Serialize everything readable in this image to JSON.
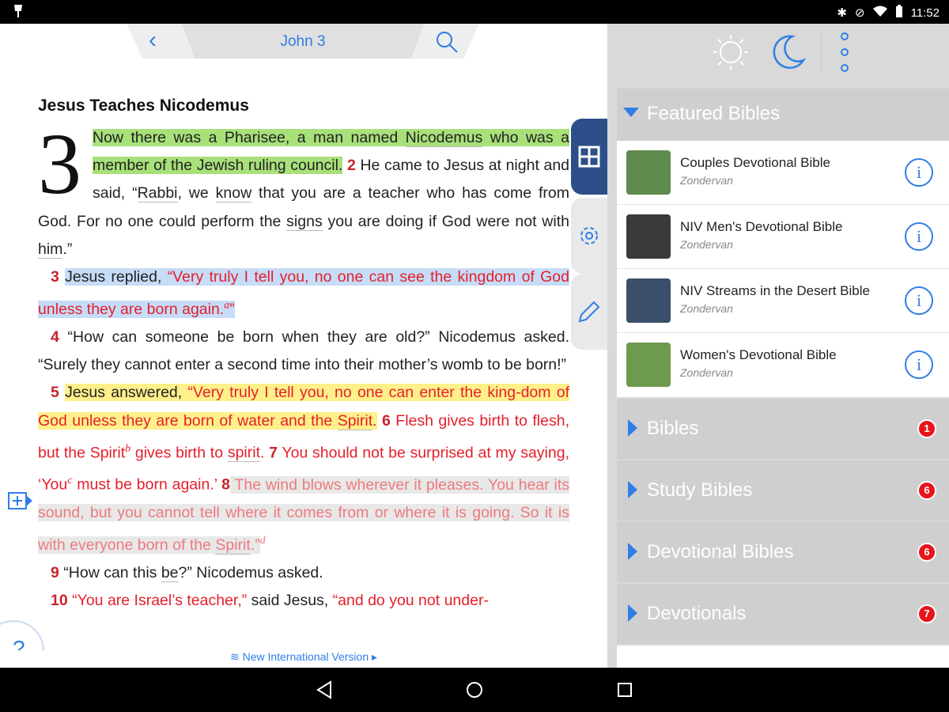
{
  "status_bar": {
    "time": "11:52"
  },
  "reader": {
    "chapter_ref": "John 3",
    "section_title": "Jesus Teaches Nicodemus",
    "chapter_number": "3",
    "version_label": "New International Version",
    "v1_a": "Now there was a Pharisee, a man named ",
    "v1_b": "Nicodemus",
    "v1_c": " who was a member of the Jewish ruling council.",
    "v2_num": "2",
    "v2_a": " He came to Jesus at night and said, “",
    "v2_rabbi": "Rabbi",
    "v2_b": ", we ",
    "v2_know": "know",
    "v2_c": " that you are a teacher who has come from God. For no one could perform the ",
    "v2_signs": "signs",
    "v2_d": " you are doing if God were not with ",
    "v2_him": "him",
    "v2_e": ".”",
    "v3_num": "3",
    "v3_a": "Jesus replied, ",
    "v3_b": "“Very truly I tell you, no one can see the kingdom of God unless they are born again.",
    "v3_sup": "a",
    "v3_c": "”",
    "v4_num": "4",
    "v4_a": " “How can someone be born when they are old?” Nicodemus asked. “Surely they cannot enter a second time into their mother’s womb to be born!”",
    "v5_num": "5",
    "v5_a": "Jesus answered, ",
    "v5_b": "“Very truly I tell you, no one can enter the king-dom of God unless they are born of water and the ",
    "v5_spirit": "Spirit",
    "v5_c": ".",
    "v6_num": "6",
    "v6_a": " Flesh gives birth to flesh, but the Spirit",
    "v6_sup": "b",
    "v6_b": " gives birth to ",
    "v6_spirit": "spirit",
    "v6_c": ".",
    "v7_num": "7",
    "v7_a": " You should not be surprised at my saying, ‘You",
    "v7_sup": "c",
    "v7_b": " must be born again.’",
    "v8_num": "8",
    "v8_a": " The wind blows wherever it pleases. You hear its sound, but you cannot tell where it comes from or where it is going. So it is with everyone born of the ",
    "v8_spirit": "Spirit",
    "v8_b": ".”",
    "v8_sup": "d",
    "v9_num": "9",
    "v9_a": " “How can this ",
    "v9_be": "be",
    "v9_b": "?” Nicodemus asked.",
    "v10_num": "10",
    "v10_a": " “You are Israel’s teacher,”",
    "v10_b": " said Jesus, ",
    "v10_c": "“and do you not under-"
  },
  "store": {
    "featured_label": "Featured Bibles",
    "books": [
      {
        "title": "Couples Devotional Bible",
        "publisher": "Zondervan",
        "cover": "#5f8a4e"
      },
      {
        "title": "NIV Men's Devotional Bible",
        "publisher": "Zondervan",
        "cover": "#3a3a3a"
      },
      {
        "title": "NIV Streams in the Desert Bible",
        "publisher": "Zondervan",
        "cover": "#3b4f6b"
      },
      {
        "title": "Women's Devotional Bible",
        "publisher": "Zondervan",
        "cover": "#6d9a4f"
      }
    ],
    "categories": [
      {
        "label": "Bibles",
        "count": "1"
      },
      {
        "label": "Study Bibles",
        "count": "6"
      },
      {
        "label": "Devotional Bibles",
        "count": "6"
      },
      {
        "label": "Devotionals",
        "count": "7"
      }
    ]
  },
  "colors": {
    "accent": "#2f7ee6",
    "verse_red": "#e4202c",
    "badge": "#e8141c"
  }
}
